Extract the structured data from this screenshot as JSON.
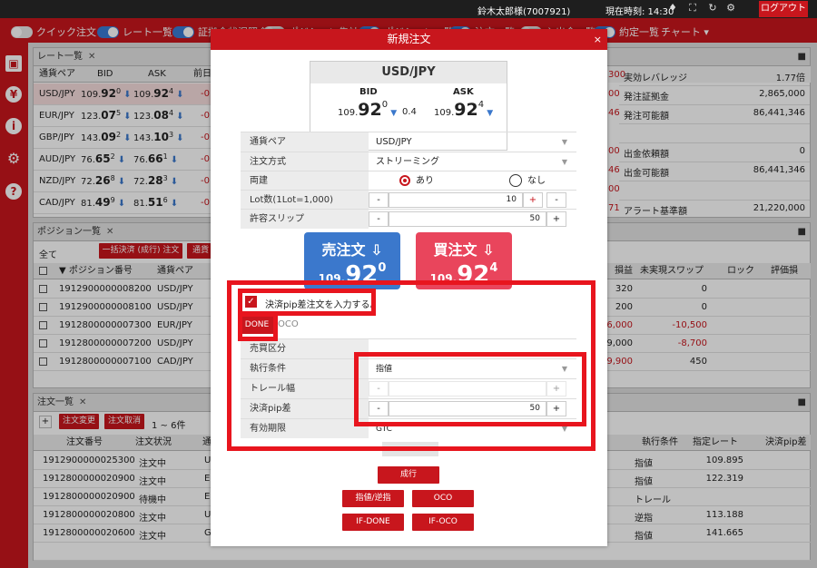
{
  "topbar": {
    "user": "鈴木太郎様(7007921)",
    "time": "現在時刻: 14:30",
    "logout": "ログアウト"
  },
  "menubar": [
    {
      "label": "クイック注文",
      "on": false
    },
    {
      "label": "レート一覧",
      "on": true
    },
    {
      "label": "証拠金状況照会",
      "on": true
    },
    {
      "label": "ポジション集計",
      "on": false
    },
    {
      "label": "ポジション一覧",
      "on": true
    },
    {
      "label": "注文一覧",
      "on": true
    },
    {
      "label": "入出金一覧",
      "on": false
    },
    {
      "label": "約定一覧",
      "on": true
    }
  ],
  "menu_chart": "チャート ▾",
  "rates": {
    "title": "レート一覧",
    "cols": [
      "通貨ペア",
      "BID",
      "ASK",
      "前日"
    ],
    "rows": [
      {
        "pair": "USD/JPY",
        "bid_a": "109.",
        "bid_b": "92",
        "bid_c": "0",
        "ask_a": "109.",
        "ask_b": "92",
        "ask_c": "4",
        "chg": "-0."
      },
      {
        "pair": "EUR/JPY",
        "bid_a": "123.",
        "bid_b": "07",
        "bid_c": "5",
        "ask_a": "123.",
        "ask_b": "08",
        "ask_c": "4",
        "chg": "-0."
      },
      {
        "pair": "GBP/JPY",
        "bid_a": "143.",
        "bid_b": "09",
        "bid_c": "2",
        "ask_a": "143.",
        "ask_b": "10",
        "ask_c": "3",
        "chg": "-0."
      },
      {
        "pair": "AUD/JPY",
        "bid_a": "76.",
        "bid_b": "65",
        "bid_c": "2",
        "ask_a": "76.",
        "ask_b": "66",
        "ask_c": "1",
        "chg": "-0."
      },
      {
        "pair": "NZD/JPY",
        "bid_a": "72.",
        "bid_b": "26",
        "bid_c": "8",
        "ask_a": "72.",
        "ask_b": "28",
        "ask_c": "3",
        "chg": "-0."
      },
      {
        "pair": "CAD/JPY",
        "bid_a": "81.",
        "bid_b": "49",
        "bid_c": "9",
        "ask_a": "81.",
        "ask_b": "51",
        "ask_c": "6",
        "chg": "-0."
      }
    ]
  },
  "margin": {
    "rows": [
      {
        "num": "300",
        "label": "実効レバレッジ",
        "value": "1.77倍"
      },
      {
        "num": "00",
        "label": "発注証拠金",
        "value": "2,865,000"
      },
      {
        "num": "46",
        "label": "発注可能額",
        "value": "86,441,346"
      },
      {
        "num": "",
        "label": "",
        "value": ""
      },
      {
        "num": "00",
        "label": "出金依頼額",
        "value": "0"
      },
      {
        "num": "46",
        "label": "出金可能額",
        "value": "86,441,346"
      },
      {
        "num": "00",
        "label": "",
        "value": ""
      },
      {
        "num": "71",
        "label": "アラート基準額",
        "value": "21,220,000"
      }
    ]
  },
  "positions": {
    "title": "ポジション一覧",
    "filter": "全て",
    "btn1": "一括決済 (成行) 注文",
    "btn2": "通貨",
    "cols": [
      "▼ ポジション番号",
      "通貨ペア",
      "損益",
      "未実現スワップ",
      "ロック",
      "評価損"
    ],
    "rows": [
      {
        "id": "1912900000008200",
        "pair": "USD/JPY",
        "pl": "320",
        "swap": "0",
        "plred": false,
        "swapred": false
      },
      {
        "id": "1912900000008100",
        "pair": "USD/JPY",
        "pl": "200",
        "swap": "0",
        "plred": false,
        "swapred": false
      },
      {
        "id": "1912800000007300",
        "pair": "EUR/JPY",
        "pl": "56,000",
        "swap": "-10,500",
        "plred": true,
        "swapred": true
      },
      {
        "id": "1912800000007200",
        "pair": "USD/JPY",
        "pl": "99,000",
        "swap": "-8,700",
        "plred": false,
        "swapred": true
      },
      {
        "id": "1912800000007100",
        "pair": "CAD/JPY",
        "pl": "9,900",
        "swap": "450",
        "plred": true,
        "swapred": false
      },
      {
        "id": "",
        "pair": "",
        "pl": "",
        "swap": "",
        "plred": false,
        "swapred": false
      }
    ]
  },
  "orders": {
    "title": "注文一覧",
    "add": "+",
    "btn_change": "注文変更",
    "btn_cancel": "注文取消",
    "paging": "1 ~ 6件",
    "cols": [
      "注文番号",
      "注文状況",
      "通",
      "執行条件",
      "指定レート",
      "決済pip差"
    ],
    "rows": [
      {
        "id": "1912900000025300",
        "status": "注文中",
        "cur": "U",
        "cond": "指値",
        "rate": "109.895"
      },
      {
        "id": "1912800000020900",
        "status": "注文中",
        "cur": "E",
        "cond": "指値",
        "rate": "122.319"
      },
      {
        "id": "1912800000020900",
        "status": "待機中",
        "cur": "E",
        "cond": "トレール",
        "rate": ""
      },
      {
        "id": "1912800000020800",
        "status": "注文中",
        "cur": "U",
        "cond": "逆指",
        "rate": "113.188"
      },
      {
        "id": "1912800000020600",
        "status": "注文中",
        "cur": "G",
        "cond": "指値",
        "rate": "141.665"
      },
      {
        "id": "",
        "status": "",
        "cur": "",
        "cond": "",
        "rate": ""
      }
    ]
  },
  "modal": {
    "title": "新規注文",
    "close": "×",
    "pair": "USD/JPY",
    "bid_label": "BID",
    "ask_label": "ASK",
    "bid": {
      "a": "109.",
      "b": "92",
      "c": "0"
    },
    "spread": "0.4",
    "ask": {
      "a": "109.",
      "b": "92",
      "c": "4"
    },
    "form": {
      "pair_label": "通貨ペア",
      "pair_value": "USD/JPY",
      "method_label": "注文方式",
      "method_value": "ストリーミング",
      "both_label": "両建",
      "both_yes": "あり",
      "both_no": "なし",
      "lot_label": "Lot数(1Lot=1,000)",
      "lot_value": "10",
      "slip_label": "許容スリップ",
      "slip_value": "50"
    },
    "sell": {
      "label": "売注文",
      "a": "109.",
      "b": "92",
      "c": "0"
    },
    "buy": {
      "label": "買注文",
      "a": "109.",
      "b": "92",
      "c": "4"
    },
    "settle_check": "決済pip差注文を入力する。",
    "done_tab": "DONE",
    "oco_tab": "OCO",
    "settle": {
      "side_label": "売買区分",
      "cond_label": "執行条件",
      "cond_value": "指値",
      "trail_label": "トレール幅",
      "pip_label": "決済pip差",
      "pip_value": "50",
      "expiry_label": "有効期限",
      "expiry_value": "GTC"
    },
    "btn_market": "成行",
    "btn_limit": "指値/逆指",
    "btn_oco": "OCO",
    "btn_ifdone": "IF-DONE",
    "btn_ifoco": "IF-OCO"
  },
  "icons": [
    "bell-icon",
    "fullscreen-icon",
    "refresh-icon",
    "gear-icon",
    "save-icon",
    "yen-icon",
    "info-icon",
    "settings-icon",
    "help-icon"
  ],
  "colors": {
    "brand": "#c8161d",
    "sell": "#3b78cc",
    "buy": "#e9455c",
    "highlight": "#e8151e"
  }
}
